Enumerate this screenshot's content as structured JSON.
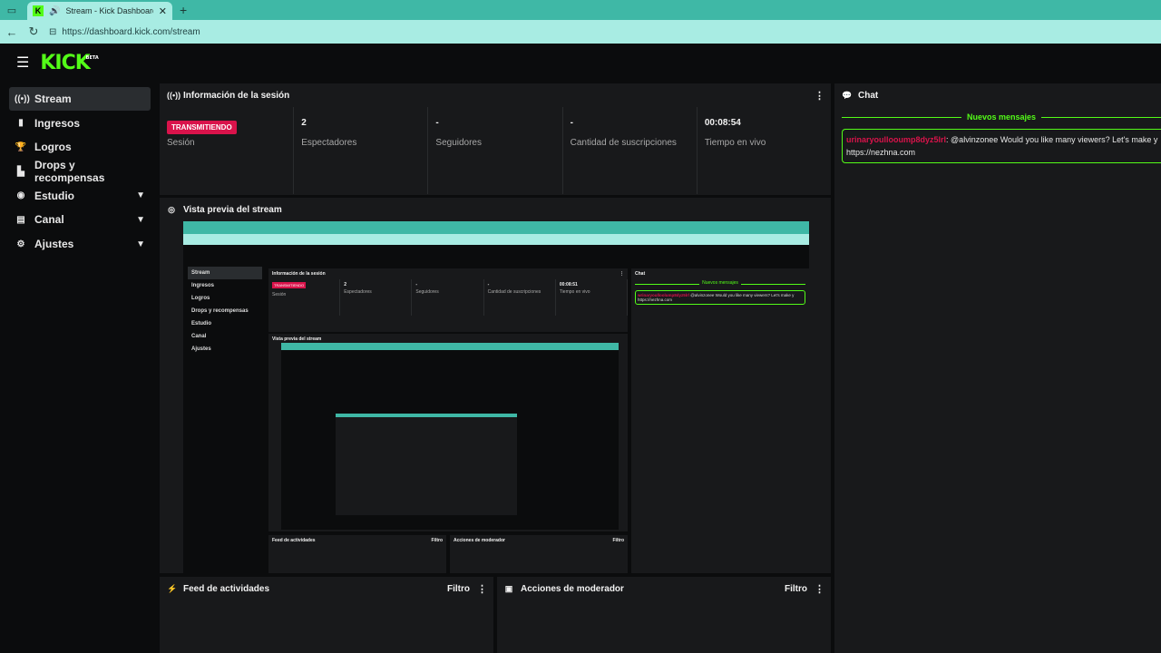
{
  "browser": {
    "tab_title": "Stream - Kick Dashboard",
    "url": "https://dashboard.kick.com/stream"
  },
  "brand": {
    "logo": "KICK",
    "beta": "BETA",
    "accent": "#53fc18"
  },
  "sidebar": {
    "items": [
      {
        "label": "Stream",
        "icon": "broadcast-icon"
      },
      {
        "label": "Ingresos",
        "icon": "bar-chart-icon"
      },
      {
        "label": "Logros",
        "icon": "trophy-icon"
      },
      {
        "label": "Drops y recompensas",
        "icon": "drops-icon"
      },
      {
        "label": "Estudio",
        "icon": "studio-icon"
      },
      {
        "label": "Canal",
        "icon": "channel-icon"
      },
      {
        "label": "Ajustes",
        "icon": "gear-icon"
      }
    ]
  },
  "session": {
    "title": "Información de la sesión",
    "status_badge": "TRANSMITIENDO",
    "status_label": "Sesión",
    "stats": [
      {
        "value": "2",
        "label": "Espectadores"
      },
      {
        "value": "-",
        "label": "Seguidores"
      },
      {
        "value": "-",
        "label": "Cantidad de suscripciones"
      },
      {
        "value": "00:08:54",
        "label": "Tiempo en vivo"
      }
    ]
  },
  "preview": {
    "title": "Vista previa del stream",
    "inner": {
      "session_title": "Información de la sesión",
      "badge": "TRANSMITIENDO",
      "labels": [
        "Sesión",
        "Espectadores",
        "Seguidores",
        "Cantidad de suscripciones",
        "Tiempo en vivo"
      ],
      "values": [
        "",
        "2",
        "-",
        "-",
        "00:08:51"
      ],
      "preview_title": "Vista previa del stream",
      "chat_title": "Chat",
      "nuevos": "Nuevos mensajes",
      "msg_user": "wrinaryoulloolump8dyz5lrl",
      "msg_text": "@alvinzonee Would you like many viewers? Let's make y",
      "msg_link": "https://nezhna.com",
      "feed": "Feed de actividades",
      "mod": "Acciones de moderador",
      "filtro": "Filtro"
    }
  },
  "chat": {
    "title": "Chat",
    "new_messages": "Nuevos mensajes",
    "message": {
      "user": "urinaryoullooump8dyz5lrl",
      "text": "@alvinzonee Would you like many viewers? Let's make y",
      "link": "https://nezhna.com"
    }
  },
  "feed": {
    "title": "Feed de actividades",
    "filter": "Filtro"
  },
  "mod": {
    "title": "Acciones de moderador",
    "filter": "Filtro"
  }
}
